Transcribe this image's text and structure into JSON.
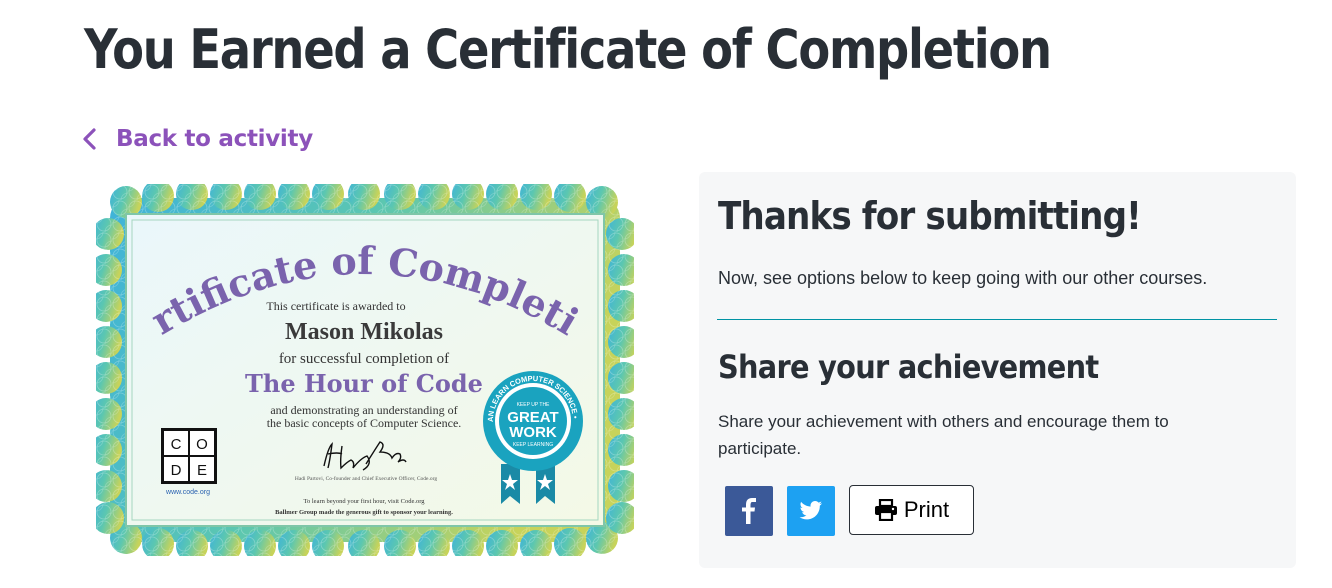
{
  "page": {
    "title": "You Earned a Certificate of Completion"
  },
  "nav": {
    "back_label": "Back to activity"
  },
  "certificate": {
    "heading": "Certificate of Completion",
    "awarded_to": "This certificate is awarded to",
    "recipient": "Mason Mikolas",
    "completion_of": "for successful completion of",
    "course": "The Hour of Code",
    "understanding_1": "and demonstrating an understanding of",
    "understanding_2": "the basic concepts of Computer Science.",
    "logo_letters": [
      "C",
      "O",
      "D",
      "E"
    ],
    "logo_url": "www.code.org",
    "signature": "Hadi Partovi",
    "signer_title": "Hadi Partovi, Co-founder and Chief Executive Officer, Code.org",
    "footer_1": "To learn beyond your first hour, visit Code.org",
    "footer_2": "Ballmer Group made the generous gift to sponsor your learning.",
    "badge_arc": "ANYONE CAN LEARN COMPUTER SCIENCE • CODE.ORG",
    "badge_top": "KEEP UP THE",
    "badge_main_1": "GREAT",
    "badge_main_2": "WORK",
    "badge_bottom": "KEEP LEARNING"
  },
  "panel": {
    "heading": "Thanks for submitting!",
    "subtext": "Now, see options below to keep going with our other courses.",
    "share_heading": "Share your achievement",
    "share_text": "Share your achievement with others and encourage them to participate.",
    "print_label": "Print"
  },
  "icons": {
    "back": "chevron-left-icon",
    "facebook": "facebook-icon",
    "twitter": "twitter-icon",
    "print": "printer-icon"
  },
  "colors": {
    "accent": "#8c52ba",
    "divider": "#0093a4",
    "facebook": "#3b5998",
    "twitter": "#1da1f2",
    "cert_purple": "#7a63ad",
    "badge": "#1aa3bf"
  }
}
